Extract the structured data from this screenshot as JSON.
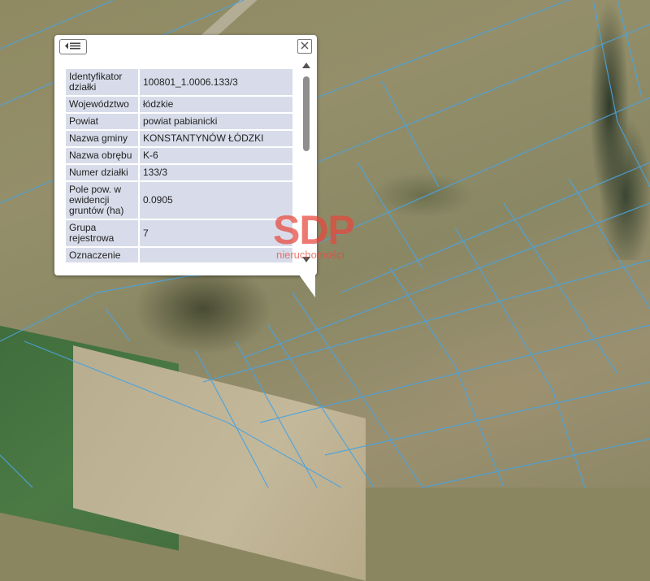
{
  "popup": {
    "back_icon": "list-back-icon",
    "close_icon": "close-icon",
    "rows": [
      {
        "key": "Identyfikator działki",
        "value": "100801_1.0006.133/3"
      },
      {
        "key": "Województwo",
        "value": "łódzkie"
      },
      {
        "key": "Powiat",
        "value": "powiat pabianicki"
      },
      {
        "key": "Nazwa gminy",
        "value": "KONSTANTYNÓW ŁÓDZKI"
      },
      {
        "key": "Nazwa obrębu",
        "value": "K-6"
      },
      {
        "key": "Numer działki",
        "value": "133/3"
      },
      {
        "key": "Pole pow. w ewidencji gruntów (ha)",
        "value": "0.0905"
      },
      {
        "key": "Grupa rejestrowa",
        "value": "7"
      },
      {
        "key": "Oznaczenie",
        "value": ""
      }
    ]
  },
  "watermark": {
    "logo": "SDP",
    "sub": "nieruchomości"
  },
  "colors": {
    "parcel_line": "#4aa3df",
    "row_bg": "#d8dcea",
    "watermark": "#e6463c"
  }
}
